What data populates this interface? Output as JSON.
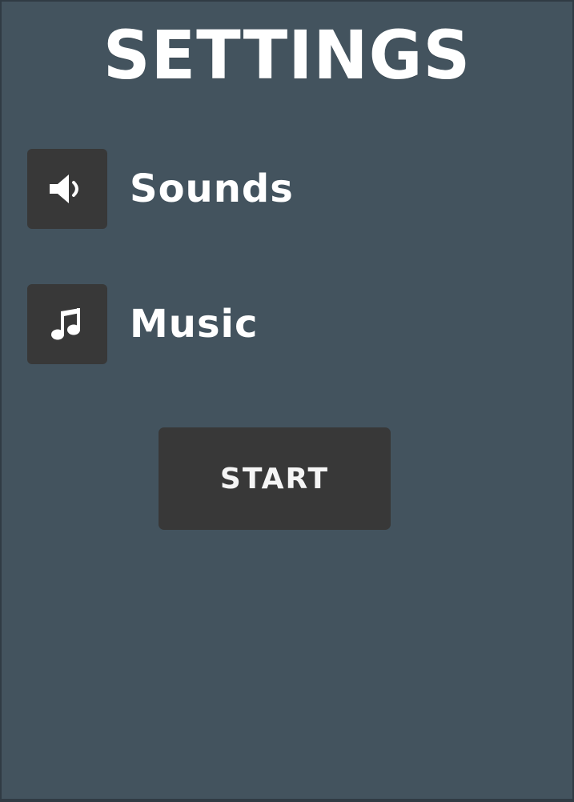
{
  "screen": {
    "title": "SETTINGS"
  },
  "settings": {
    "items": [
      {
        "label": "Sounds",
        "icon": "speaker-icon"
      },
      {
        "label": "Music",
        "icon": "music-note-icon"
      }
    ]
  },
  "actions": {
    "start_label": "START"
  },
  "colors": {
    "background": "#43535e",
    "tile": "#383838",
    "text": "#ffffff"
  }
}
